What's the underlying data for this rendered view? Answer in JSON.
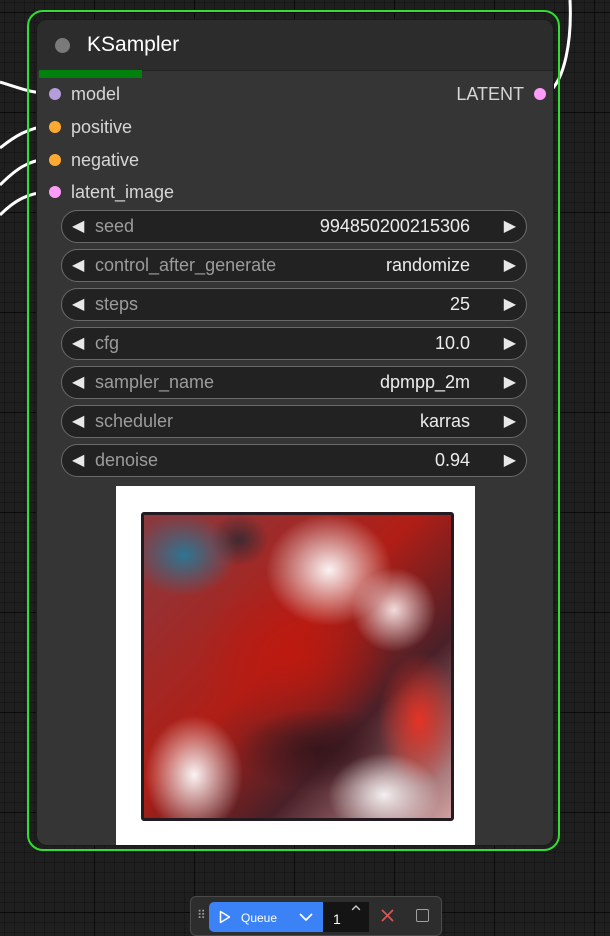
{
  "node": {
    "title": "KSampler",
    "inputs": [
      {
        "label": "model",
        "color": "#b39ddb"
      },
      {
        "label": "positive",
        "color": "#ffa931"
      },
      {
        "label": "negative",
        "color": "#ffa931"
      },
      {
        "label": "latent_image",
        "color": "#ff9cf9"
      }
    ],
    "output": {
      "label": "LATENT",
      "color": "#ff9cf9"
    },
    "progress": 0.2,
    "widgets": [
      {
        "name": "seed",
        "value": "994850200215306"
      },
      {
        "name": "control_after_generate",
        "value": "randomize"
      },
      {
        "name": "steps",
        "value": "25"
      },
      {
        "name": "cfg",
        "value": "10.0"
      },
      {
        "name": "sampler_name",
        "value": "dpmpp_2m"
      },
      {
        "name": "scheduler",
        "value": "karras"
      },
      {
        "name": "denoise",
        "value": "0.94"
      }
    ],
    "arrows": {
      "left": "◀",
      "right": "▶"
    }
  },
  "queue": {
    "button_label": "Queue",
    "batch_count": "1",
    "icons": [
      "drag-handle-icon",
      "play-icon",
      "chevron-down-icon",
      "spinner-up-icon",
      "clear-queue-icon",
      "stop-icon"
    ]
  },
  "colors": {
    "selection_outline": "#33dd33",
    "node_body": "#353535",
    "queue_button": "#3b82f6",
    "clear_icon": "#e05252"
  }
}
